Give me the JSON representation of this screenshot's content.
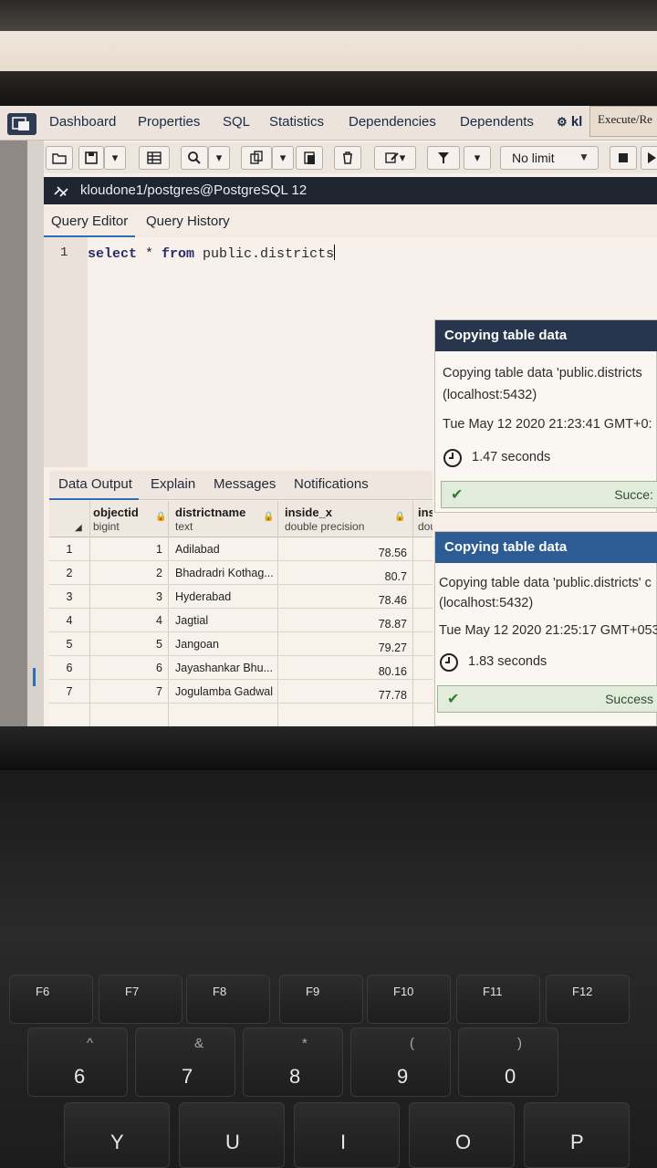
{
  "tabbar": {
    "tabs": [
      "Dashboard",
      "Properties",
      "SQL",
      "Statistics",
      "Dependencies",
      "Dependents"
    ],
    "partial_tab": "kl",
    "tooltip": "Execute/Re"
  },
  "toolbar": {
    "limit_label": "No limit"
  },
  "connection": {
    "label": "kloudone1/postgres@PostgreSQL 12"
  },
  "editor_tabs": [
    "Query Editor",
    "Query History"
  ],
  "editor": {
    "line_number": "1",
    "sql_keyword_select": "select",
    "sql_star": " * ",
    "sql_keyword_from": "from",
    "sql_table": " public.districts"
  },
  "result_tabs": [
    "Data Output",
    "Explain",
    "Messages",
    "Notifications"
  ],
  "grid": {
    "columns": [
      {
        "name": "objectid",
        "type": "bigint"
      },
      {
        "name": "districtname",
        "type": "text"
      },
      {
        "name": "inside_x",
        "type": "double precision"
      },
      {
        "name": "ins",
        "type": "double precision"
      }
    ],
    "rows": [
      {
        "rn": "1",
        "id": "1",
        "name": "Adilabad",
        "x": "78.56"
      },
      {
        "rn": "2",
        "id": "2",
        "name": "Bhadradri Kothag...",
        "x": "80.7"
      },
      {
        "rn": "3",
        "id": "3",
        "name": "Hyderabad",
        "x": "78.46"
      },
      {
        "rn": "4",
        "id": "4",
        "name": "Jagtial",
        "x": "78.87"
      },
      {
        "rn": "5",
        "id": "5",
        "name": "Jangoan",
        "x": "79.27"
      },
      {
        "rn": "6",
        "id": "6",
        "name": "Jayashankar Bhu...",
        "x": "80.16"
      },
      {
        "rn": "7",
        "id": "7",
        "name": "Jogulamba Gadwal",
        "x": "77.78"
      }
    ]
  },
  "notifications": [
    {
      "title": "Copying table data",
      "line1": "Copying table data 'public.districts",
      "line2": "(localhost:5432)",
      "time": "Tue May 12 2020 21:23:41 GMT+0:",
      "duration": "1.47 seconds",
      "status": "Succe:"
    },
    {
      "title": "Copying table data",
      "line1": "Copying table data 'public.districts' c",
      "line2": "(localhost:5432)",
      "time": "Tue May 12 2020 21:25:17 GMT+053",
      "duration": "1.83 seconds",
      "status": "Success"
    }
  ],
  "keyboard": {
    "fkeys": [
      "F6",
      "F7",
      "F8",
      "F9",
      "F10",
      "F11",
      "F12"
    ],
    "numrow": [
      {
        "main": "6",
        "sub": "^"
      },
      {
        "main": "7",
        "sub": "&"
      },
      {
        "main": "8",
        "sub": "*"
      },
      {
        "main": "9",
        "sub": "("
      },
      {
        "main": "0",
        "sub": ")"
      }
    ],
    "letters": [
      "Y",
      "U",
      "I",
      "O",
      "P"
    ]
  },
  "colors": {
    "notif_header": "#28364d",
    "connection_bar": "#1e2531",
    "accent": "#2f6db4",
    "success_check": "#2e7d32"
  }
}
